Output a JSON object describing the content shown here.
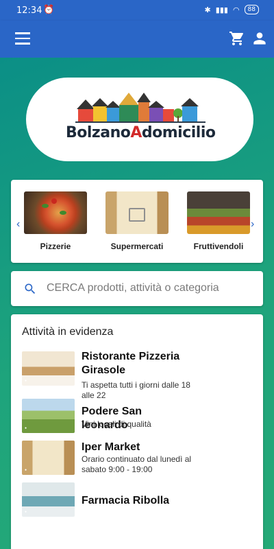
{
  "status": {
    "time": "12:34",
    "battery": "88"
  },
  "header": {
    "menu_icon": "hamburger-icon",
    "cart_icon": "cart-icon",
    "user_icon": "user-icon"
  },
  "logo": {
    "brand_start": "Bolzano",
    "brand_a": "A",
    "brand_end": "domicilio"
  },
  "categories": [
    {
      "label": "Pizzerie"
    },
    {
      "label": "Supermercati"
    },
    {
      "label": "Fruttivendoli"
    }
  ],
  "search": {
    "placeholder": "CERCA prodotti, attività o categoria"
  },
  "featured": {
    "title": "Attività in evidenza",
    "items": [
      {
        "name": "Ristorante Pizzeria Girasole",
        "desc": "Ti aspetta tutti i giorni dalle 18 alle 22"
      },
      {
        "name": "Podere San leonardo",
        "desc": "Vini locali di qualità"
      },
      {
        "name": "Iper Market",
        "desc": "Orario continuato dal lunedì al sabato 9:00 - 19:00"
      },
      {
        "name": "Farmacia Ribolla",
        "desc": ""
      }
    ]
  },
  "colors": {
    "appbar": "#2a66c7",
    "accent": "#2a66c7",
    "bg": "#1aa084"
  }
}
